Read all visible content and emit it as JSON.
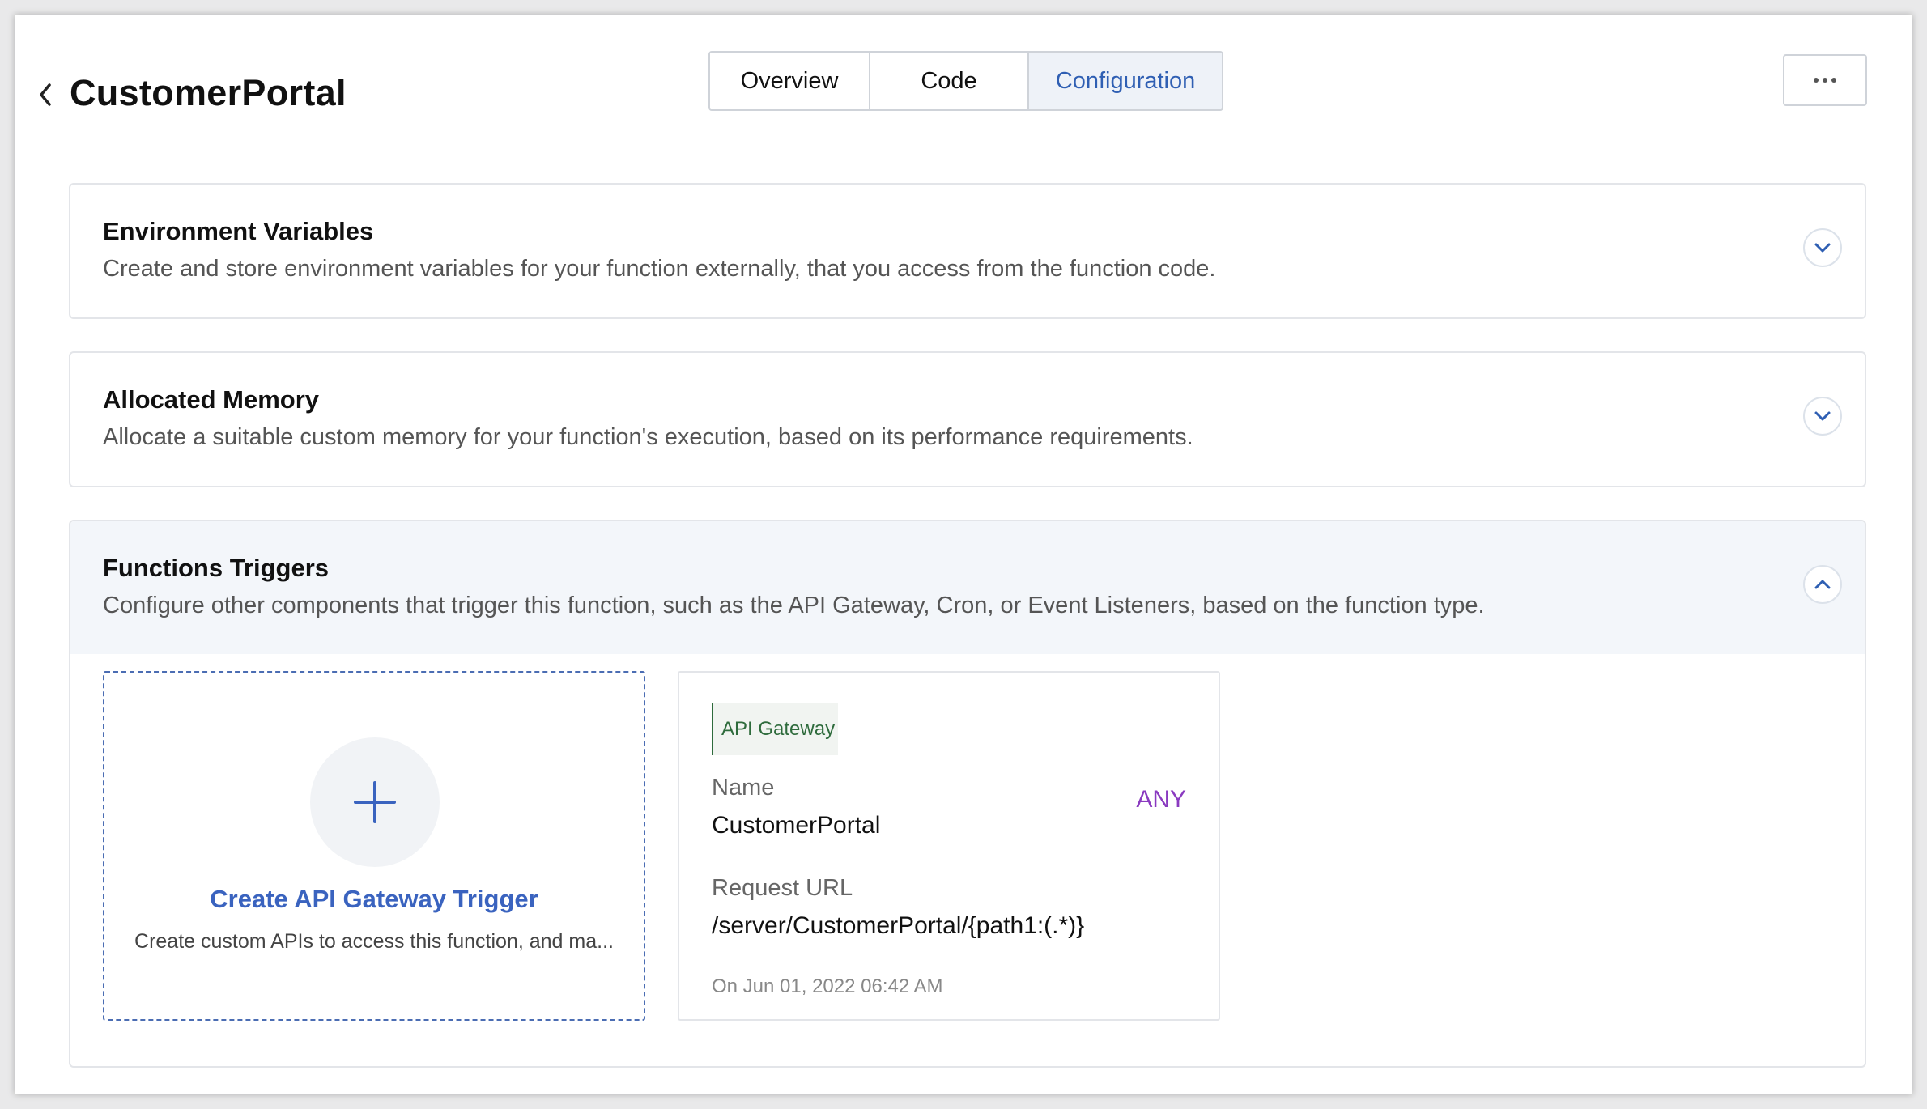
{
  "header": {
    "title": "CustomerPortal",
    "tabs": [
      {
        "label": "Overview",
        "active": false
      },
      {
        "label": "Code",
        "active": false
      },
      {
        "label": "Configuration",
        "active": true
      }
    ]
  },
  "sections": {
    "env": {
      "title": "Environment Variables",
      "description": "Create and store environment variables for your function externally, that you access from the function code.",
      "expanded": false
    },
    "memory": {
      "title": "Allocated Memory",
      "description": "Allocate a suitable custom memory for your function's execution, based on its performance requirements.",
      "expanded": false
    },
    "triggers": {
      "title": "Functions Triggers",
      "description": "Configure other components that trigger this function, such as the API Gateway, Cron, or Event Listeners, based on the function type.",
      "expanded": true,
      "create_card": {
        "title": "Create API Gateway Trigger",
        "description": "Create custom APIs to access this function, and ma..."
      },
      "trigger_card": {
        "tag": "API Gateway",
        "name_label": "Name",
        "name_value": "CustomerPortal",
        "method": "ANY",
        "url_label": "Request URL",
        "url_value": "/server/CustomerPortal/{path1:(.*)}",
        "date": "On Jun 01, 2022 06:42 AM"
      }
    }
  },
  "colors": {
    "accent": "#3a63bf",
    "active_tab_bg": "#eef2f8",
    "tag_green": "#2e6b3c",
    "method_purple": "#8a3ac0"
  },
  "icons": {
    "back": "chevron-left-icon",
    "more": "more-horizontal-icon",
    "expand": "chevron-down-icon",
    "collapse": "chevron-up-icon",
    "add": "plus-icon"
  }
}
